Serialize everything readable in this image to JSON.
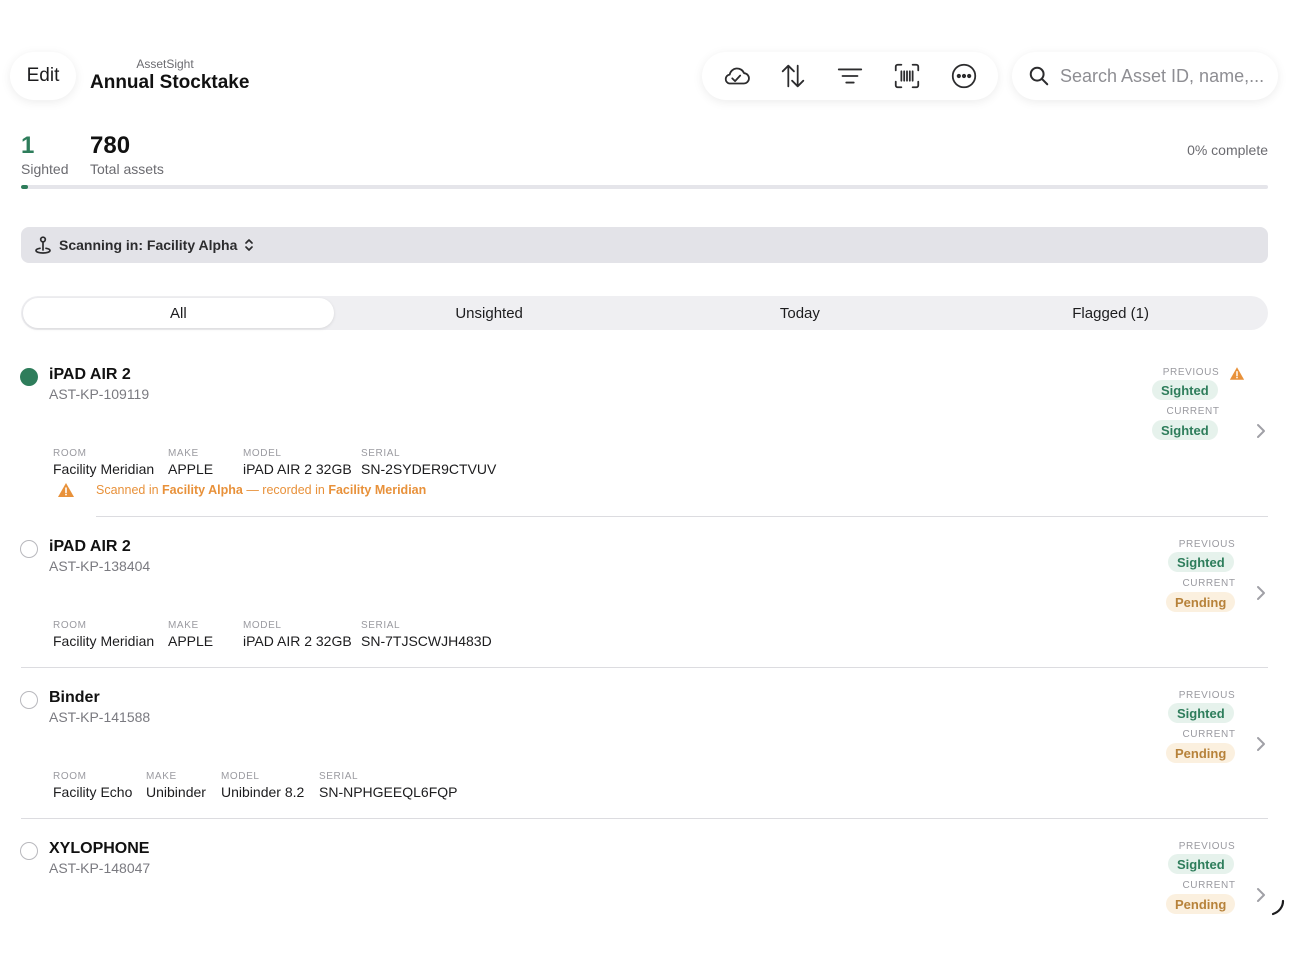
{
  "header": {
    "edit_label": "Edit",
    "app_name": "AssetSight",
    "title": "Annual Stocktake",
    "toolbar_icons": [
      "cloud-sync-icon",
      "sort-icon",
      "filter-icon",
      "barcode-scan-icon",
      "more-icon"
    ],
    "search_placeholder": "Search Asset ID, name,..."
  },
  "stats": {
    "sighted_value": "1",
    "sighted_label": "Sighted",
    "total_value": "780",
    "total_label": "Total assets",
    "percent_complete": "0% complete",
    "progress_fraction": 0.006
  },
  "location": {
    "text": "Scanning in: Facility Alpha"
  },
  "tabs": [
    {
      "label": "All",
      "active": true
    },
    {
      "label": "Unsighted",
      "active": false
    },
    {
      "label": "Today",
      "active": false
    },
    {
      "label": "Flagged (1)",
      "active": false
    }
  ],
  "assets": [
    {
      "name": "iPAD AIR 2",
      "id": "AST-KP-109119",
      "sighted": true,
      "flagged": true,
      "labels": {
        "room": "ROOM",
        "make": "MAKE",
        "model": "MODEL",
        "serial": "SERIAL"
      },
      "room": "Facility Meridian",
      "make": "APPLE",
      "model": "iPAD AIR 2 32GB",
      "serial": "SN-2SYDER9CTVUV",
      "previous_label": "PREVIOUS",
      "previous": "Sighted",
      "current_label": "CURRENT",
      "current": "Sighted",
      "warning": {
        "prefix": "Scanned in ",
        "scanned_location": "Facility Alpha",
        "middle": " — recorded in ",
        "recorded_location": "Facility Meridian"
      }
    },
    {
      "name": "iPAD AIR 2",
      "id": "AST-KP-138404",
      "sighted": false,
      "labels": {
        "room": "ROOM",
        "make": "MAKE",
        "model": "MODEL",
        "serial": "SERIAL"
      },
      "room": "Facility Meridian",
      "make": "APPLE",
      "model": "iPAD AIR 2 32GB",
      "serial": "SN-7TJSCWJH483D",
      "previous_label": "PREVIOUS",
      "previous": "Sighted",
      "current_label": "CURRENT",
      "current": "Pending"
    },
    {
      "name": "Binder",
      "id": "AST-KP-141588",
      "sighted": false,
      "labels": {
        "room": "ROOM",
        "make": "MAKE",
        "model": "MODEL",
        "serial": "SERIAL"
      },
      "room": "Facility Echo",
      "make": "Unibinder",
      "model": "Unibinder 8.2",
      "serial": "SN-NPHGEEQL6FQP",
      "previous_label": "PREVIOUS",
      "previous": "Sighted",
      "current_label": "CURRENT",
      "current": "Pending"
    },
    {
      "name": "XYLOPHONE",
      "id": "AST-KP-148047",
      "sighted": false,
      "previous_label": "PREVIOUS",
      "previous": "Sighted",
      "current_label": "CURRENT",
      "current": "Pending"
    }
  ],
  "colors": {
    "accent_green": "#2e7d5b",
    "pending_orange": "#b7823a",
    "warning_orange": "#e8913a"
  }
}
